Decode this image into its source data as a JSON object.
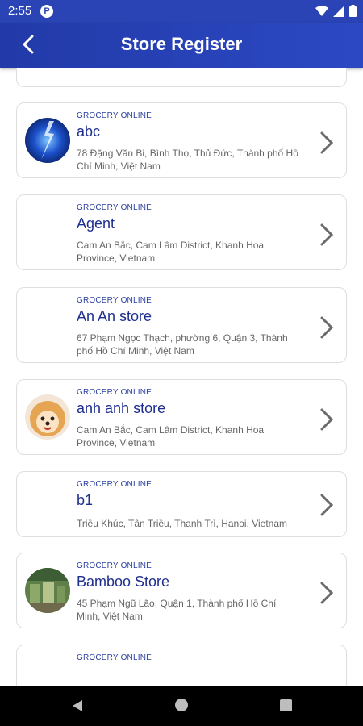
{
  "status_bar": {
    "time": "2:55",
    "app_icon_letter": "P"
  },
  "app_bar": {
    "title": "Store Register"
  },
  "stores": [
    {
      "category": "GROCERY ONLINE",
      "name": "abc",
      "address": "78 Đặng Văn Bi, Bình Thọ, Thủ Đức, Thành phố Hồ Chí Minh, Việt Nam",
      "avatar": "lightning-image"
    },
    {
      "category": "GROCERY ONLINE",
      "name": "Agent",
      "address": "Cam An Bắc, Cam Lâm District, Khanh Hoa Province, Vietnam",
      "avatar": ""
    },
    {
      "category": "GROCERY ONLINE",
      "name": "An An store",
      "address": "67 Phạm Ngọc Thạch, phường 6, Quận 3, Thành phố Hồ Chí Minh, Việt Nam",
      "avatar": ""
    },
    {
      "category": "GROCERY ONLINE",
      "name": "anh anh store",
      "address": "Cam An Bắc, Cam Lâm District, Khanh Hoa Province, Vietnam",
      "avatar": "dog-image"
    },
    {
      "category": "GROCERY ONLINE",
      "name": "b1",
      "address": "Triều Khúc, Tân Triều, Thanh Trì, Hanoi, Vietnam",
      "avatar": ""
    },
    {
      "category": "GROCERY ONLINE",
      "name": "Bamboo Store",
      "address": "45 Phạm Ngũ Lão, Quận 1, Thành phố Hồ Chí Minh, Việt Nam",
      "avatar": "market-image"
    },
    {
      "category": "GROCERY ONLINE",
      "name": "",
      "address": "",
      "avatar": ""
    }
  ],
  "colors": {
    "primary": "#2a44b6",
    "title_text": "#1f2f8f",
    "address_text": "#666666"
  }
}
